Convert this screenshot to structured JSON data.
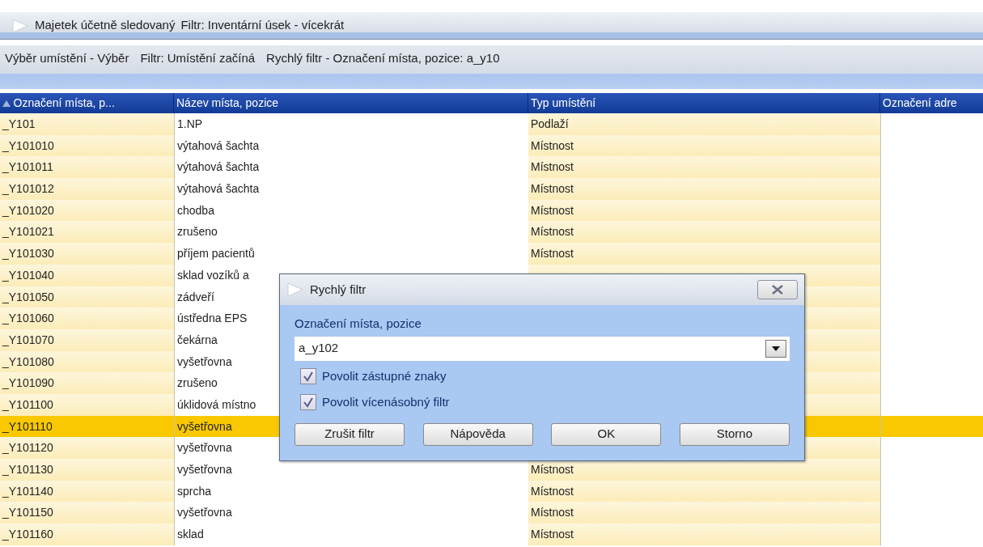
{
  "window": {
    "title": "Majetek účetně sledovaný",
    "filter": "Filtr: Inventární úsek - vícekrát"
  },
  "view_bar": {
    "title": "Výběr umístění - Výběr",
    "filter": "Filtr: Umístění začíná",
    "quick_filter": "Rychlý filtr - Označení místa, pozice: a_y10"
  },
  "table": {
    "columns": [
      {
        "label": "Označení místa, p...",
        "sorted": true
      },
      {
        "label": "Název místa, pozice",
        "sorted": false
      },
      {
        "label": "Typ umístění",
        "sorted": false
      },
      {
        "label": "Označení adre",
        "sorted": false
      }
    ],
    "rows": [
      {
        "cells": [
          "_Y101",
          "1.NP",
          "Podlaží"
        ],
        "selected": false
      },
      {
        "cells": [
          "_Y101010",
          "výtahová šachta",
          "Místnost"
        ],
        "selected": false
      },
      {
        "cells": [
          "_Y101011",
          "výtahová šachta",
          "Místnost"
        ],
        "selected": false
      },
      {
        "cells": [
          "_Y101012",
          "výtahová šachta",
          "Místnost"
        ],
        "selected": false
      },
      {
        "cells": [
          "_Y101020",
          "chodba",
          "Místnost"
        ],
        "selected": false
      },
      {
        "cells": [
          "_Y101021",
          "zrušeno",
          "Místnost"
        ],
        "selected": false
      },
      {
        "cells": [
          "_Y101030",
          "příjem pacientů",
          "Místnost"
        ],
        "selected": false
      },
      {
        "cells": [
          "_Y101040",
          "sklad vozíků a"
        ],
        "selected": false
      },
      {
        "cells": [
          "_Y101050",
          "zádveří"
        ],
        "selected": false
      },
      {
        "cells": [
          "_Y101060",
          "ústředna EPS"
        ],
        "selected": false
      },
      {
        "cells": [
          "_Y101070",
          "čekárna"
        ],
        "selected": false
      },
      {
        "cells": [
          "_Y101080",
          "vyšetřovna"
        ],
        "selected": false
      },
      {
        "cells": [
          "_Y101090",
          "zrušeno"
        ],
        "selected": false
      },
      {
        "cells": [
          "_Y101100",
          "úklidová místno"
        ],
        "selected": false
      },
      {
        "cells": [
          "_Y101110",
          "vyšetřovna"
        ],
        "selected": true
      },
      {
        "cells": [
          "_Y101120",
          "vyšetřovna"
        ],
        "selected": false
      },
      {
        "cells": [
          "_Y101130",
          "vyšetřovna",
          "Místnost"
        ],
        "selected": false
      },
      {
        "cells": [
          "_Y101140",
          "sprcha",
          "Místnost"
        ],
        "selected": false
      },
      {
        "cells": [
          "_Y101150",
          "vyšetřovna",
          "Místnost"
        ],
        "selected": false
      },
      {
        "cells": [
          "_Y101160",
          "sklad",
          "Místnost"
        ],
        "selected": false
      }
    ]
  },
  "dialog": {
    "title": "Rychlý filtr",
    "field_label": "Označení místa, pozice",
    "value": "a_y102",
    "checkboxes": [
      {
        "label": "Povolit zástupné znaky",
        "checked": true
      },
      {
        "label": "Povolit vícenásobný filtr",
        "checked": true
      }
    ],
    "buttons": [
      "Zrušit filtr",
      "Nápověda",
      "OK",
      "Storno"
    ]
  }
}
